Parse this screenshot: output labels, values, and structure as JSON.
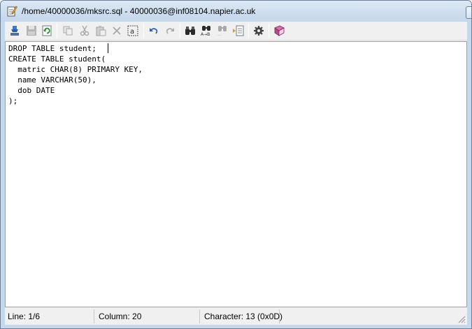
{
  "window": {
    "title": "/home/40000036/mksrc.sql - 40000036@inf08104.napier.ac.uk"
  },
  "toolbar": {
    "buttons": [
      {
        "name": "upload-icon",
        "enabled": true
      },
      {
        "name": "save-icon",
        "enabled": false
      },
      {
        "name": "refresh-icon",
        "enabled": true
      },
      {
        "name": "copy-icon",
        "enabled": false
      },
      {
        "name": "cut-icon",
        "enabled": false
      },
      {
        "name": "paste-icon",
        "enabled": false
      },
      {
        "name": "delete-icon",
        "enabled": false
      },
      {
        "name": "select-all-icon",
        "enabled": true
      },
      {
        "name": "undo-icon",
        "enabled": true
      },
      {
        "name": "redo-icon",
        "enabled": false
      },
      {
        "name": "find-icon",
        "enabled": true
      },
      {
        "name": "replace-icon",
        "enabled": true
      },
      {
        "name": "find-next-icon",
        "enabled": false
      },
      {
        "name": "goto-line-icon",
        "enabled": true
      },
      {
        "name": "settings-gear-icon",
        "enabled": true
      },
      {
        "name": "help-book-icon",
        "enabled": true
      }
    ]
  },
  "editor": {
    "lines": [
      "DROP TABLE student;",
      "CREATE TABLE student(",
      "  matric CHAR(8) PRIMARY KEY,",
      "  name VARCHAR(50),",
      "  dob DATE",
      ");"
    ]
  },
  "status": {
    "line": "Line: 1/6",
    "column": "Column: 20",
    "character": "Character: 13 (0x0D)"
  }
}
